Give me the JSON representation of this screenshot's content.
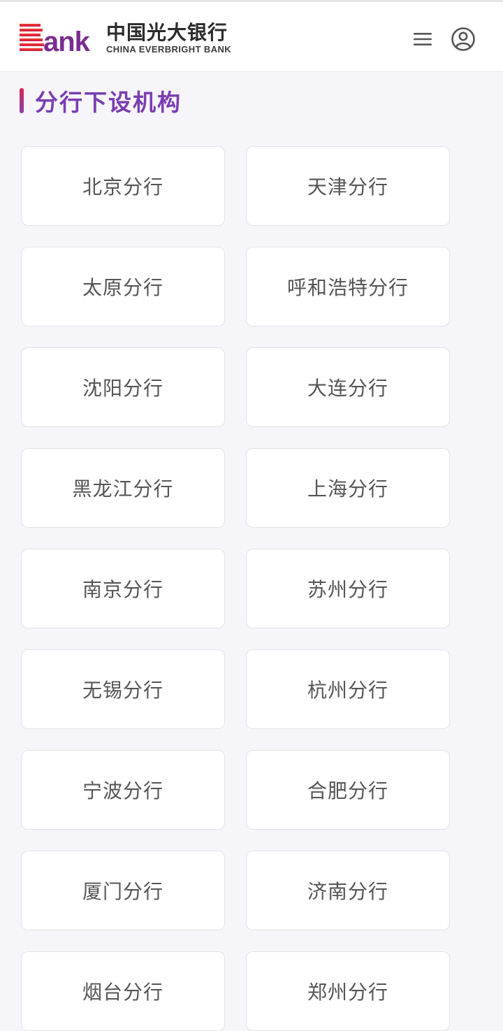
{
  "header": {
    "logo_mark": "Bank",
    "logo_cn": "中国光大银行",
    "logo_en": "CHINA EVERBRIGHT BANK",
    "menu_icon": "hamburger-menu-icon",
    "user_icon": "user-circle-icon"
  },
  "colors": {
    "brand_purple": "#7a3db3",
    "brand_red": "#d9254f",
    "background": "#f6f5f9",
    "card": "#ffffff"
  },
  "section": {
    "title": "分行下设机构"
  },
  "branches": [
    "北京分行",
    "天津分行",
    "太原分行",
    "呼和浩特分行",
    "沈阳分行",
    "大连分行",
    "黑龙江分行",
    "上海分行",
    "南京分行",
    "苏州分行",
    "无锡分行",
    "杭州分行",
    "宁波分行",
    "合肥分行",
    "厦门分行",
    "济南分行",
    "烟台分行",
    "郑州分行"
  ]
}
